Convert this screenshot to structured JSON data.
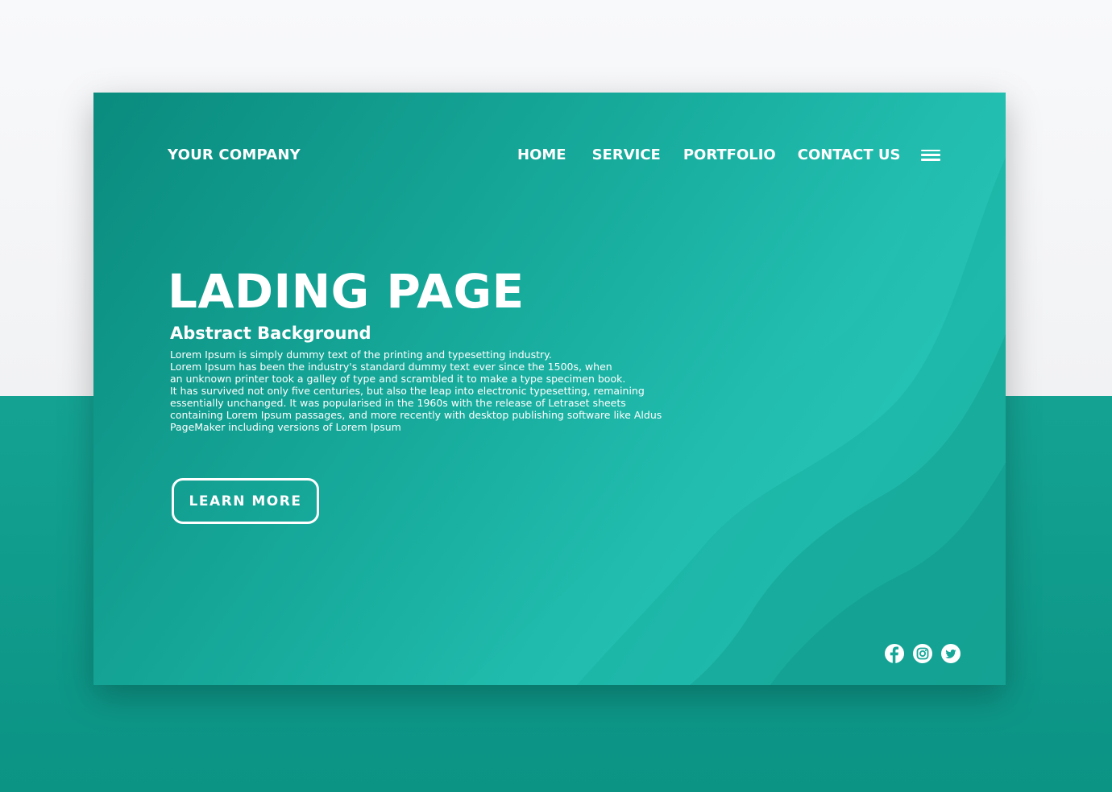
{
  "brand": {
    "name": "YOUR COMPANY"
  },
  "nav": {
    "items": [
      {
        "label": "HOME"
      },
      {
        "label": "SERVICE"
      },
      {
        "label": "PORTFOLIO"
      },
      {
        "label": "CONTACT US"
      }
    ],
    "menu_icon": "hamburger-menu-icon"
  },
  "hero": {
    "title": "LADING PAGE",
    "subtitle": "Abstract Background",
    "body_lines": [
      "Lorem Ipsum is simply dummy text of the printing and typesetting industry.",
      "Lorem Ipsum has been the industry's standard dummy text ever since the 1500s, when",
      "an unknown printer took a galley of type and scrambled it to make a type specimen book.",
      "It has survived not only five centuries, but also the leap into electronic typesetting, remaining",
      "essentially unchanged. It was popularised in the 1960s with the release of Letraset sheets",
      "containing Lorem Ipsum passages, and more recently with desktop publishing software like Aldus",
      "PageMaker including versions of Lorem Ipsum"
    ],
    "cta_label": "LEARN MORE"
  },
  "social": {
    "icons": [
      "facebook-icon",
      "instagram-icon",
      "twitter-icon"
    ]
  },
  "colors": {
    "accent_teal": "#18ad9e",
    "dark_teal": "#0a8b7e",
    "light_teal": "#27c6b8",
    "page_top_background": "#f6f7f9",
    "text": "#ffffff"
  }
}
